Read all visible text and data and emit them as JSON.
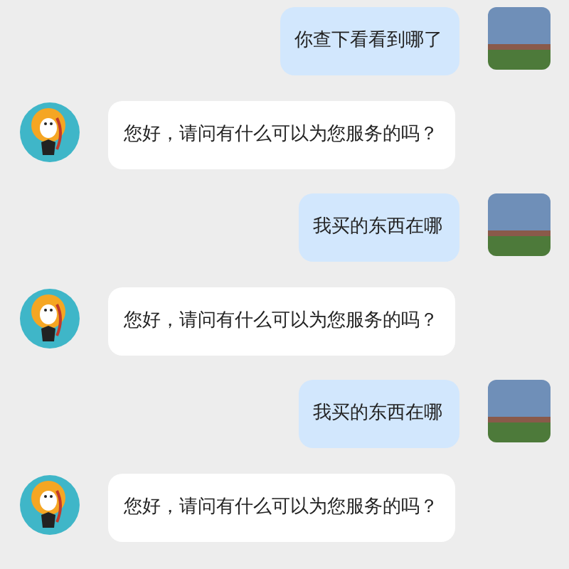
{
  "messages": [
    {
      "kind": "sent",
      "text": "你查下看看到哪了"
    },
    {
      "kind": "received",
      "text": "您好，请问有什么可以为您服务的吗？"
    },
    {
      "kind": "sent",
      "text": "我买的东西在哪"
    },
    {
      "kind": "received",
      "text": "您好，请问有什么可以为您服务的吗？"
    },
    {
      "kind": "sent",
      "text": "我买的东西在哪"
    },
    {
      "kind": "received",
      "text": "您好，请问有什么可以为您服务的吗？"
    }
  ]
}
